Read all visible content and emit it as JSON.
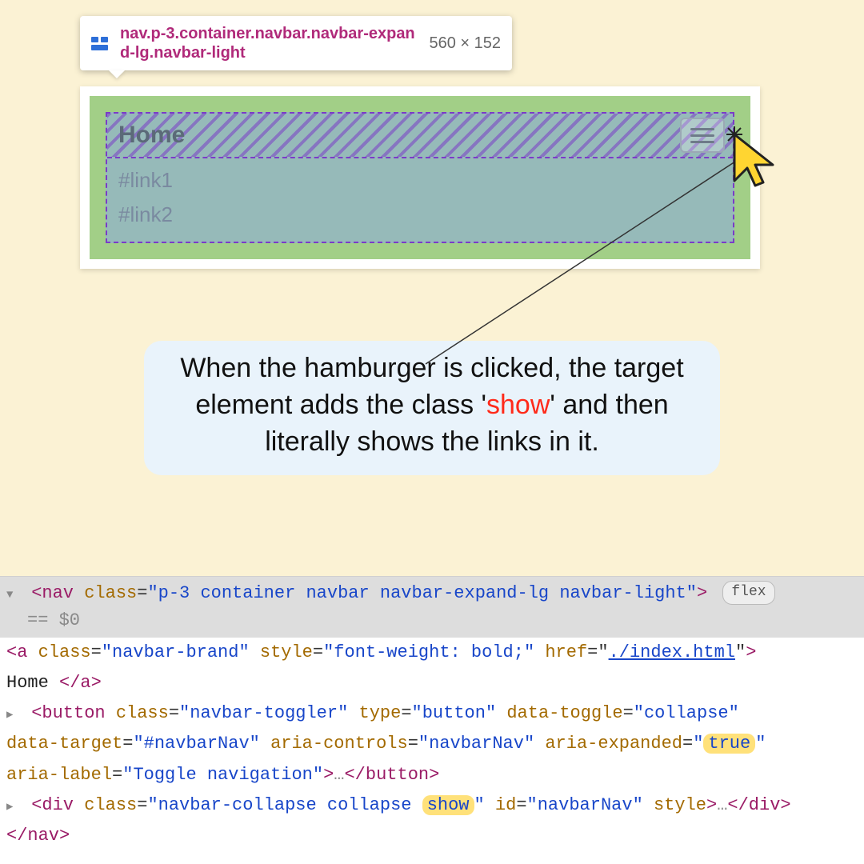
{
  "tooltip": {
    "selector": "nav.p-3.container.navbar.navbar-expand-lg.navbar-light",
    "dimensions": "560 × 152"
  },
  "nav": {
    "brand": "Home",
    "link1": "#link1",
    "link2": "#link2"
  },
  "explain": {
    "pre": "When the hamburger is clicked, the target element adds the class '",
    "highlight": "show",
    "post": "' and then literally shows the links in it."
  },
  "devtools": {
    "flex_badge": "flex",
    "eqdollar": "== $0",
    "nav_open_tag": "nav",
    "nav_class_attr": "class",
    "nav_class_val": "p-3 container navbar navbar-expand-lg navbar-light",
    "a_tag": "a",
    "a_class_val": "navbar-brand",
    "a_style_attr": "style",
    "a_style_val": "font-weight: bold;",
    "a_href_attr": "href",
    "a_href_val": "./index.html",
    "a_text": "Home",
    "btn_tag": "button",
    "btn_class_val": "navbar-toggler",
    "btn_type_attr": "type",
    "btn_type_val": "button",
    "btn_dtoggle_attr": "data-toggle",
    "btn_dtoggle_val": "collapse",
    "btn_dtarget_attr": "data-target",
    "btn_dtarget_val": "#navbarNav",
    "btn_ariactrl_attr": "aria-controls",
    "btn_ariactrl_val": "navbarNav",
    "btn_ariaexp_attr": "aria-expanded",
    "btn_ariaexp_val": "true",
    "btn_arialabel_attr": "aria-label",
    "btn_arialabel_val": "Toggle navigation",
    "ellipsis": "…",
    "div_tag": "div",
    "div_class_pre": "navbar-collapse collapse ",
    "div_class_hl": "show",
    "div_id_attr": "id",
    "div_id_val": "navbarNav",
    "div_style_attr": "style"
  }
}
